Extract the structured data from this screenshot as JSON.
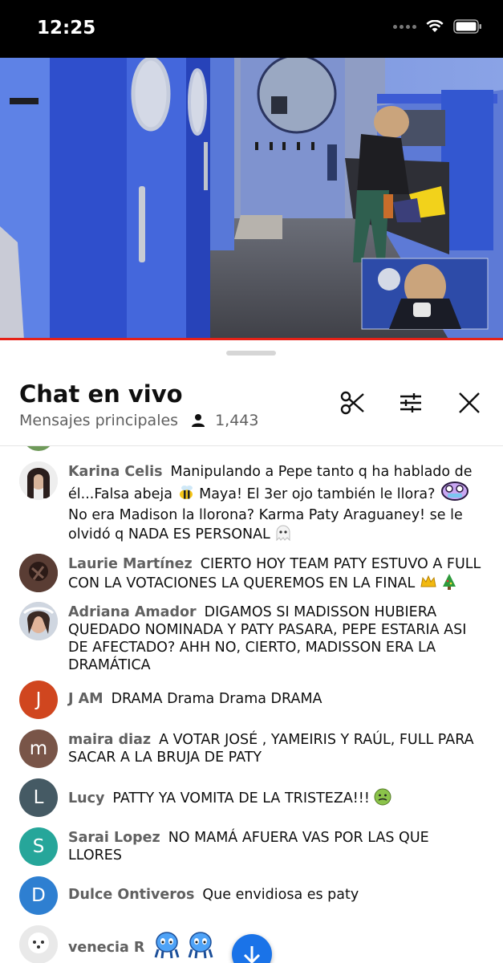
{
  "status_bar": {
    "time": "12:25"
  },
  "chat": {
    "title": "Chat en vivo",
    "mode": "Mensajes principales",
    "viewer_count": "1,443"
  },
  "messages": [
    {
      "author": "Karina Celis",
      "text": "Manipulando a Pepe tanto q ha hablado de él...Falsa abeja",
      "text2": "Maya! El 3er ojo también le llora?",
      "text3": "No era Madison la llorona? Karma Paty Araguaney! se le olvidó q NADA ES PERSONAL",
      "avatar": "photo"
    },
    {
      "author": "Laurie Martínez",
      "text": "CIERTO HOY TEAM PATY ESTUVO A FULL CON LA VOTACIONES LA QUEREMOS EN LA FINAL",
      "avatar": "photo"
    },
    {
      "author": "Adriana Amador",
      "text": "DIGAMOS SI MADISSON HUBIERA QUEDADO NOMINADA Y PATY PASARA, PEPE ESTARIA ASI DE AFECTADO? AHH NO, CIERTO, MADISSON ERA LA DRAMÁTICA",
      "avatar": "photo"
    },
    {
      "author": "J AM",
      "text": "DRAMA Drama Drama DRAMA",
      "initial": "J",
      "color": "#d0461f"
    },
    {
      "author": "maira diaz",
      "text": "A VOTAR JOSÉ , YAMEIRIS Y RAÚL, FULL PARA SACAR A LA BRUJA DE PATY",
      "initial": "m",
      "color": "#795548"
    },
    {
      "author": "Lucy",
      "text": "PATTY YA VOMITA DE LA TRISTEZA!!!",
      "initial": "L",
      "color": "#455a64"
    },
    {
      "author": "Sarai Lopez",
      "text": "NO MAMÁ AFUERA VAS POR LAS QUE LLORES",
      "initial": "S",
      "color": "#26a69a"
    },
    {
      "author": "Dulce Ontiveros",
      "text": "Que envidiosa es paty",
      "initial": "D",
      "color": "#2e7fd1"
    },
    {
      "author": "venecia R",
      "text": "",
      "avatar": "photo"
    }
  ],
  "colors": {
    "accent": "#1a73e8",
    "progress": "#e62117"
  }
}
